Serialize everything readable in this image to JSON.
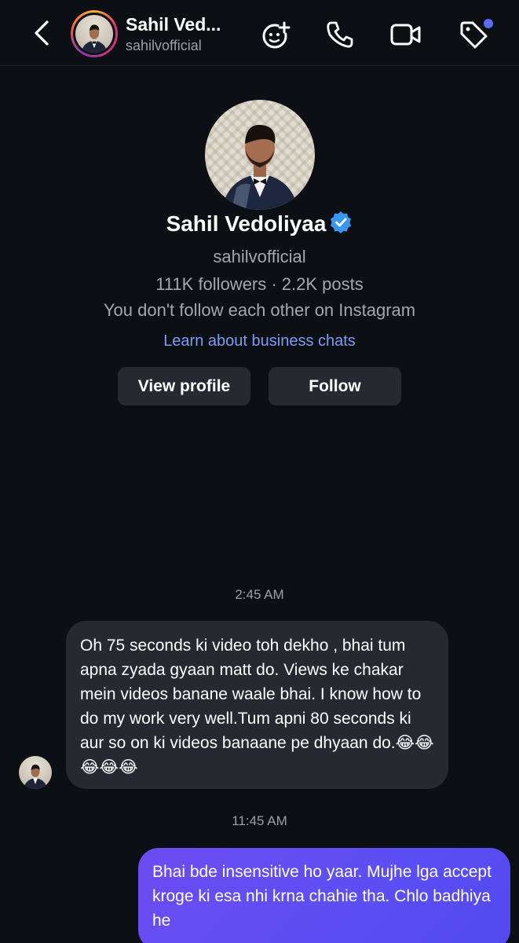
{
  "header": {
    "name": "Sahil Ved...",
    "username": "sahilvofficial",
    "icons": [
      "back-chevron-icon",
      "effects-icon",
      "phone-icon",
      "video-icon",
      "tag-icon"
    ],
    "notification_color": "#5b6cf6"
  },
  "profile": {
    "name": "Sahil Vedoliyaa",
    "username": "sahilvofficial",
    "stats": "111K followers · 2.2K posts",
    "follow_status": "You don't follow each other on Instagram",
    "business_link": "Learn about business chats",
    "view_profile_label": "View profile",
    "follow_label": "Follow",
    "verified_color": "#3897f0"
  },
  "messages": {
    "time1": "2:45 AM",
    "incoming_text": "Oh 75 seconds ki video toh dekho , bhai tum apna zyada gyaan matt do. Views ke chakar mein videos banane waale bhai. I know how to do my work very well.Tum apni 80 seconds ki aur so on ki videos banaane pe dhyaan do.😂😂😂😂😂",
    "time2": "11:45 AM",
    "outgoing_text": "Bhai bde insensitive ho yaar. Mujhe lga accept kroge ki esa nhi krna chahie tha. Chlo badhiya he"
  },
  "colors": {
    "background": "#0c0f14",
    "bubble_incoming": "#26292f",
    "bubble_outgoing": "#5b4ef3",
    "link": "#7f9cf5"
  }
}
